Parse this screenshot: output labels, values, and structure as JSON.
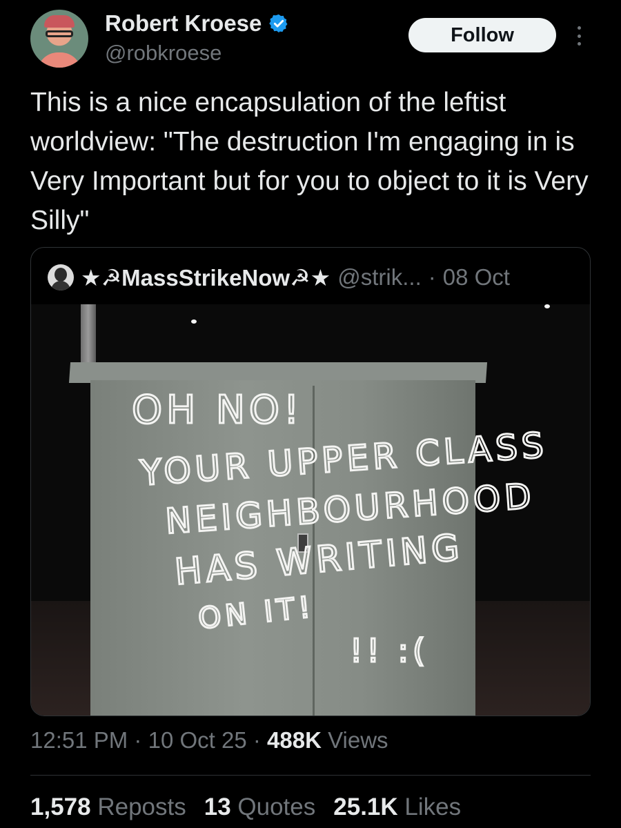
{
  "author": {
    "display_name": "Robert Kroese",
    "handle": "@robkroese",
    "verified": true,
    "verified_color": "#1d9bf0"
  },
  "actions": {
    "follow_label": "Follow"
  },
  "tweet": {
    "text": "This is a nice encapsulation of the leftist worldview: \"The destruction I'm engaging in is Very Important but for you to object to it is Very Silly\""
  },
  "quoted": {
    "name": "★☭MassStrikeNow☭★",
    "handle": "@strik...",
    "separator": "·",
    "date": "08 Oct",
    "image_text": [
      "OH NO!",
      "YOUR UPPER CLASS",
      "NEIGHBOURHOOD",
      "HAS WRITING",
      "ON IT!",
      "!! :("
    ]
  },
  "meta": {
    "time": "12:51 PM",
    "separator": "·",
    "date": "10 Oct 25",
    "views_count": "488K",
    "views_label": "Views"
  },
  "stats": {
    "reposts_count": "1,578",
    "reposts_label": "Reposts",
    "quotes_count": "13",
    "quotes_label": "Quotes",
    "likes_count": "25.1K",
    "likes_label": "Likes"
  }
}
